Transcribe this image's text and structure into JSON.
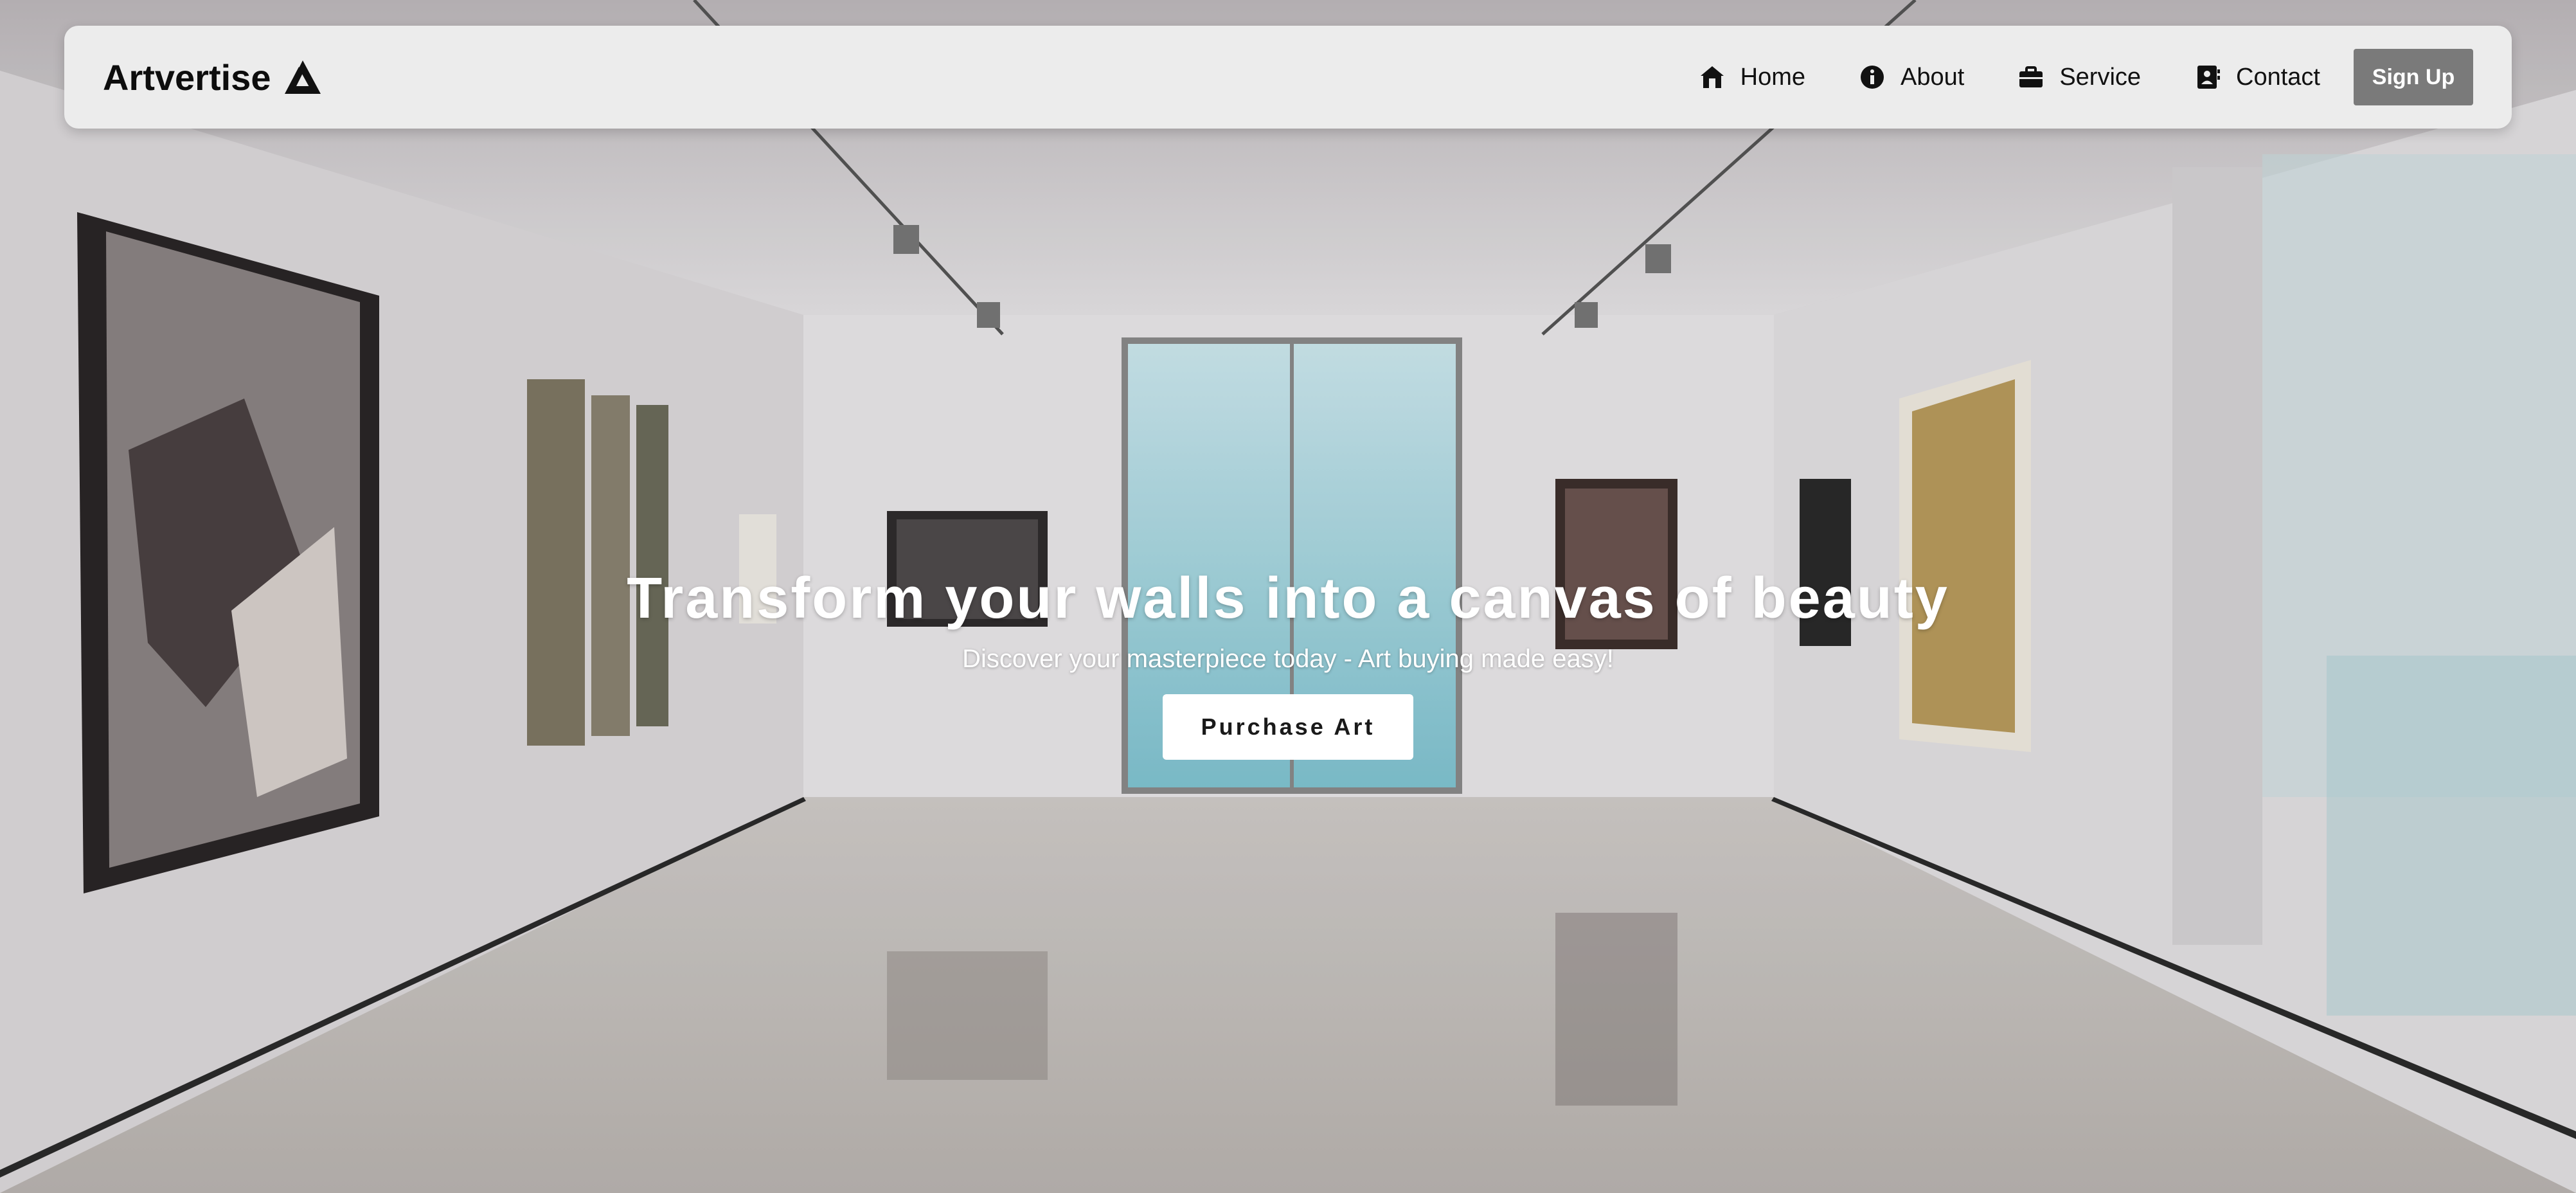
{
  "navbar": {
    "brand": "Artvertise",
    "brand_icon": "artvertise-logo-icon",
    "links": [
      {
        "label": "Home",
        "icon": "home-icon"
      },
      {
        "label": "About",
        "icon": "info-icon"
      },
      {
        "label": "Service",
        "icon": "briefcase-icon"
      },
      {
        "label": "Contact",
        "icon": "contact-card-icon"
      }
    ],
    "signup_label": "Sign Up"
  },
  "hero": {
    "title": "Transform your walls into a canvas of beauty",
    "subtitle": "Discover your masterpiece today - Art buying made easy!",
    "cta_label": "Purchase Art"
  },
  "colors": {
    "navbar_bg": "#ececec",
    "signup_bg": "#7a7a7a",
    "hero_text": "#ffffff",
    "cta_bg": "#ffffff"
  }
}
